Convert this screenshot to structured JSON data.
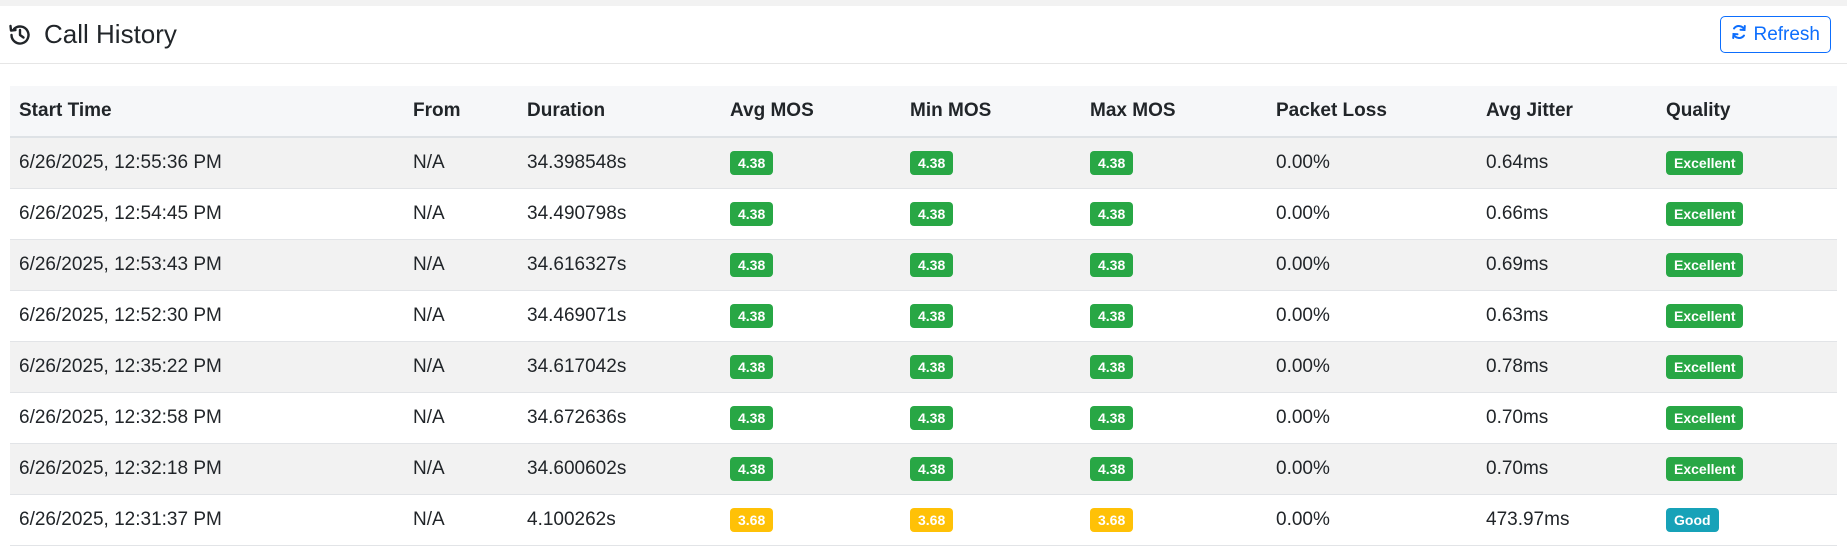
{
  "header": {
    "title": "Call History",
    "title_icon": "history-icon",
    "refresh_label": "Refresh",
    "refresh_icon": "sync-icon"
  },
  "colors": {
    "primary": "#0d6efd",
    "success": "#28a745",
    "warning": "#ffc107",
    "info": "#17a2b8"
  },
  "table": {
    "columns": [
      "Start Time",
      "From",
      "Duration",
      "Avg MOS",
      "Min MOS",
      "Max MOS",
      "Packet Loss",
      "Avg Jitter",
      "Quality"
    ],
    "rows": [
      {
        "start_time": "6/26/2025, 12:55:36 PM",
        "from": "N/A",
        "duration": "34.398548s",
        "avg_mos": "4.38",
        "min_mos": "4.38",
        "max_mos": "4.38",
        "packet_loss": "0.00%",
        "avg_jitter": "0.64ms",
        "quality": "Excellent",
        "mos_level": "success",
        "quality_level": "success"
      },
      {
        "start_time": "6/26/2025, 12:54:45 PM",
        "from": "N/A",
        "duration": "34.490798s",
        "avg_mos": "4.38",
        "min_mos": "4.38",
        "max_mos": "4.38",
        "packet_loss": "0.00%",
        "avg_jitter": "0.66ms",
        "quality": "Excellent",
        "mos_level": "success",
        "quality_level": "success"
      },
      {
        "start_time": "6/26/2025, 12:53:43 PM",
        "from": "N/A",
        "duration": "34.616327s",
        "avg_mos": "4.38",
        "min_mos": "4.38",
        "max_mos": "4.38",
        "packet_loss": "0.00%",
        "avg_jitter": "0.69ms",
        "quality": "Excellent",
        "mos_level": "success",
        "quality_level": "success"
      },
      {
        "start_time": "6/26/2025, 12:52:30 PM",
        "from": "N/A",
        "duration": "34.469071s",
        "avg_mos": "4.38",
        "min_mos": "4.38",
        "max_mos": "4.38",
        "packet_loss": "0.00%",
        "avg_jitter": "0.63ms",
        "quality": "Excellent",
        "mos_level": "success",
        "quality_level": "success"
      },
      {
        "start_time": "6/26/2025, 12:35:22 PM",
        "from": "N/A",
        "duration": "34.617042s",
        "avg_mos": "4.38",
        "min_mos": "4.38",
        "max_mos": "4.38",
        "packet_loss": "0.00%",
        "avg_jitter": "0.78ms",
        "quality": "Excellent",
        "mos_level": "success",
        "quality_level": "success"
      },
      {
        "start_time": "6/26/2025, 12:32:58 PM",
        "from": "N/A",
        "duration": "34.672636s",
        "avg_mos": "4.38",
        "min_mos": "4.38",
        "max_mos": "4.38",
        "packet_loss": "0.00%",
        "avg_jitter": "0.70ms",
        "quality": "Excellent",
        "mos_level": "success",
        "quality_level": "success"
      },
      {
        "start_time": "6/26/2025, 12:32:18 PM",
        "from": "N/A",
        "duration": "34.600602s",
        "avg_mos": "4.38",
        "min_mos": "4.38",
        "max_mos": "4.38",
        "packet_loss": "0.00%",
        "avg_jitter": "0.70ms",
        "quality": "Excellent",
        "mos_level": "success",
        "quality_level": "success"
      },
      {
        "start_time": "6/26/2025, 12:31:37 PM",
        "from": "N/A",
        "duration": "4.100262s",
        "avg_mos": "3.68",
        "min_mos": "3.68",
        "max_mos": "3.68",
        "packet_loss": "0.00%",
        "avg_jitter": "473.97ms",
        "quality": "Good",
        "mos_level": "warning",
        "quality_level": "info"
      }
    ]
  }
}
